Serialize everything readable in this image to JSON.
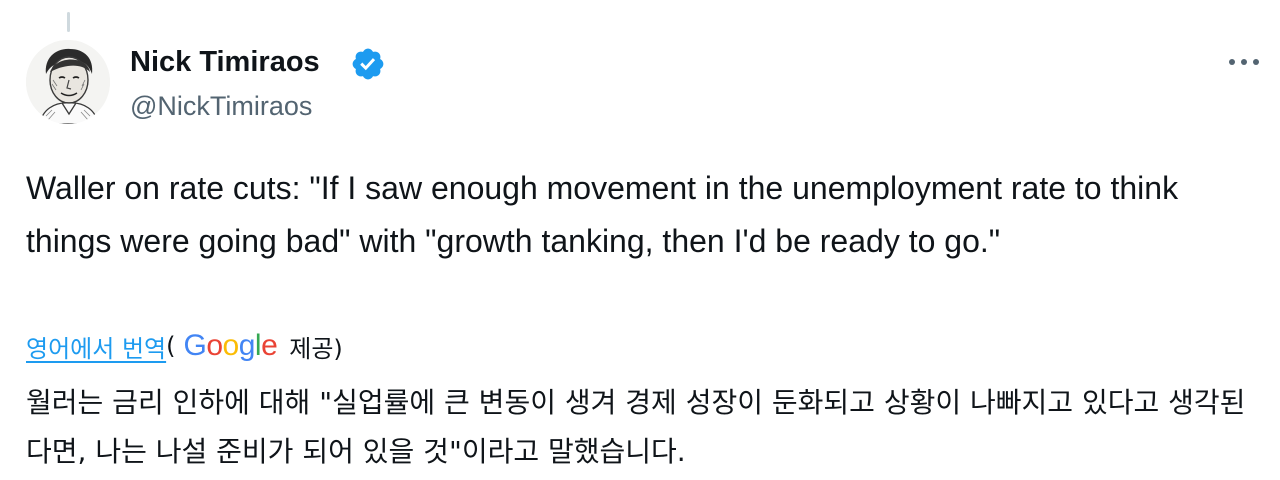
{
  "author": {
    "display_name": "Nick Timiraos",
    "handle": "@NickTimiraos",
    "verified": true,
    "avatar_icon": "portrait-sketch"
  },
  "tweet": {
    "text": "Waller on rate cuts: \"If I saw enough movement in the unemployment rate to think things were going bad\" with \"growth tanking, then I'd be ready to go.\""
  },
  "translation": {
    "link_label": "영어에서 번역",
    "open_paren": "(",
    "provider_letters": [
      "G",
      "o",
      "o",
      "g",
      "l",
      "e"
    ],
    "provided_label": "제공)",
    "text": "월러는 금리 인하에 대해 \"실업률에 큰 변동이 생겨 경제 성장이 둔화되고 상황이 나빠지고 있다고 생각된다면, 나는 나설 준비가 되어 있을 것\"이라고 말했습니다."
  },
  "menu": {
    "more_icon": "more-horizontal-icon"
  },
  "colors": {
    "accent": "#1d9bf0",
    "text_primary": "#0f1419",
    "text_secondary": "#536471",
    "thread_line": "#cfd9de",
    "google_blue": "#4285f4",
    "google_red": "#ea4335",
    "google_yellow": "#fbbc05",
    "google_green": "#34a853"
  }
}
